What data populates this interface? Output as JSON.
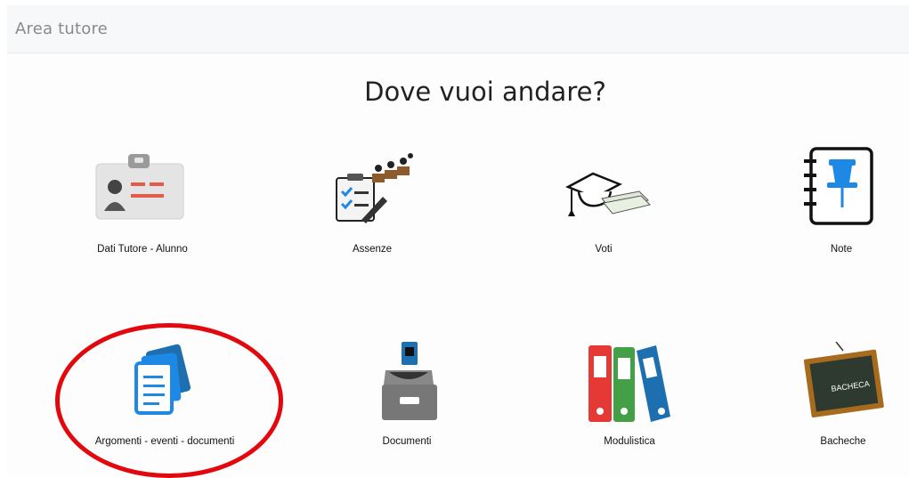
{
  "header": {
    "breadcrumb": "Area tutore"
  },
  "main": {
    "title": "Dove vuoi andare?",
    "tiles": [
      {
        "label": "Dati Tutore - Alunno",
        "icon": "id-card-icon"
      },
      {
        "label": "Assenze",
        "icon": "attendance-checklist-icon"
      },
      {
        "label": "Voti",
        "icon": "graduation-cap-icon"
      },
      {
        "label": "Note",
        "icon": "notebook-pin-icon"
      },
      {
        "label": "Argomenti - eventi - documenti",
        "icon": "documents-stack-icon"
      },
      {
        "label": "Documenti",
        "icon": "archive-drawer-icon"
      },
      {
        "label": "Modulistica",
        "icon": "binders-icon"
      },
      {
        "label": "Bacheche",
        "icon": "chalkboard-icon"
      }
    ],
    "chalkboard_text": "BACHECA"
  },
  "colors": {
    "highlight_ring": "#e3080d",
    "doc_blue": "#1e88e5",
    "binder_red": "#e53935",
    "binder_green": "#43a047",
    "binder_blue": "#1e6fb0"
  }
}
